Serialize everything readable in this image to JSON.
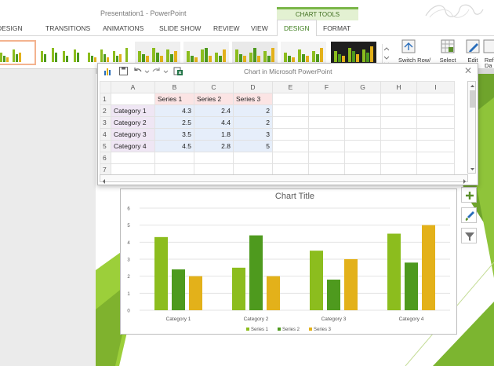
{
  "app": {
    "window_title": "Presentation1 - PowerPoint",
    "contextual_group": "CHART TOOLS"
  },
  "tabs": [
    {
      "label": "DESIGN",
      "cut": true
    },
    {
      "label": "TRANSITIONS"
    },
    {
      "label": "ANIMATIONS"
    },
    {
      "label": "SLIDE SHOW"
    },
    {
      "label": "REVIEW"
    },
    {
      "label": "VIEW"
    },
    {
      "label": "DESIGN",
      "active": true
    },
    {
      "label": "FORMAT"
    }
  ],
  "ribbon": {
    "right_buttons": [
      {
        "label": "Switch Row/",
        "icon": "switch-row-column-icon"
      },
      {
        "label": "Select",
        "icon": "select-data-icon"
      },
      {
        "label": "Edit",
        "icon": "edit-data-icon"
      },
      {
        "label": "Refr",
        "icon": "refresh-data-icon"
      }
    ],
    "second_line": [
      "",
      "",
      "",
      "Da"
    ]
  },
  "sheet": {
    "title": "Chart in Microsoft PowerPoint",
    "columns": [
      "",
      "A",
      "B",
      "C",
      "D",
      "E",
      "F",
      "G",
      "H",
      "I"
    ],
    "rows": [
      {
        "n": "1",
        "cells": [
          "",
          "Series 1",
          "Series 2",
          "Series 3"
        ]
      },
      {
        "n": "2",
        "cells": [
          "Category 1",
          "4.3",
          "2.4",
          "2"
        ]
      },
      {
        "n": "3",
        "cells": [
          "Category 2",
          "2.5",
          "4.4",
          "2"
        ]
      },
      {
        "n": "4",
        "cells": [
          "Category 3",
          "3.5",
          "1.8",
          "3"
        ]
      },
      {
        "n": "5",
        "cells": [
          "Category 4",
          "4.5",
          "2.8",
          "5"
        ]
      },
      {
        "n": "6",
        "cells": [
          "",
          "",
          "",
          ""
        ]
      },
      {
        "n": "7",
        "cells": [
          "",
          "",
          "",
          ""
        ]
      }
    ]
  },
  "chart_data": {
    "type": "bar",
    "title": "Chart Title",
    "categories": [
      "Category 1",
      "Category 2",
      "Category 3",
      "Category 4"
    ],
    "series": [
      {
        "name": "Series 1",
        "values": [
          4.3,
          2.5,
          3.5,
          4.5
        ],
        "color": "#8cbd1e"
      },
      {
        "name": "Series 2",
        "values": [
          2.4,
          4.4,
          1.8,
          2.8
        ],
        "color": "#4e9a1e"
      },
      {
        "name": "Series 3",
        "values": [
          2,
          2,
          3,
          5
        ],
        "color": "#e3b11a"
      }
    ],
    "yticks": [
      "0",
      "1",
      "2",
      "3",
      "4",
      "5",
      "6"
    ],
    "ylim": [
      0,
      6
    ],
    "grid": true,
    "legend": "bottom"
  },
  "chart_buttons": [
    {
      "name": "chart-elements-button",
      "icon": "plus-icon"
    },
    {
      "name": "chart-styles-button",
      "icon": "brush-icon"
    },
    {
      "name": "chart-filters-button",
      "icon": "funnel-icon"
    }
  ],
  "colors": {
    "accent": "#7ab648",
    "contextual_tab_bg": "#e3f1d2",
    "active_tab_text": "#3f7f1f"
  }
}
